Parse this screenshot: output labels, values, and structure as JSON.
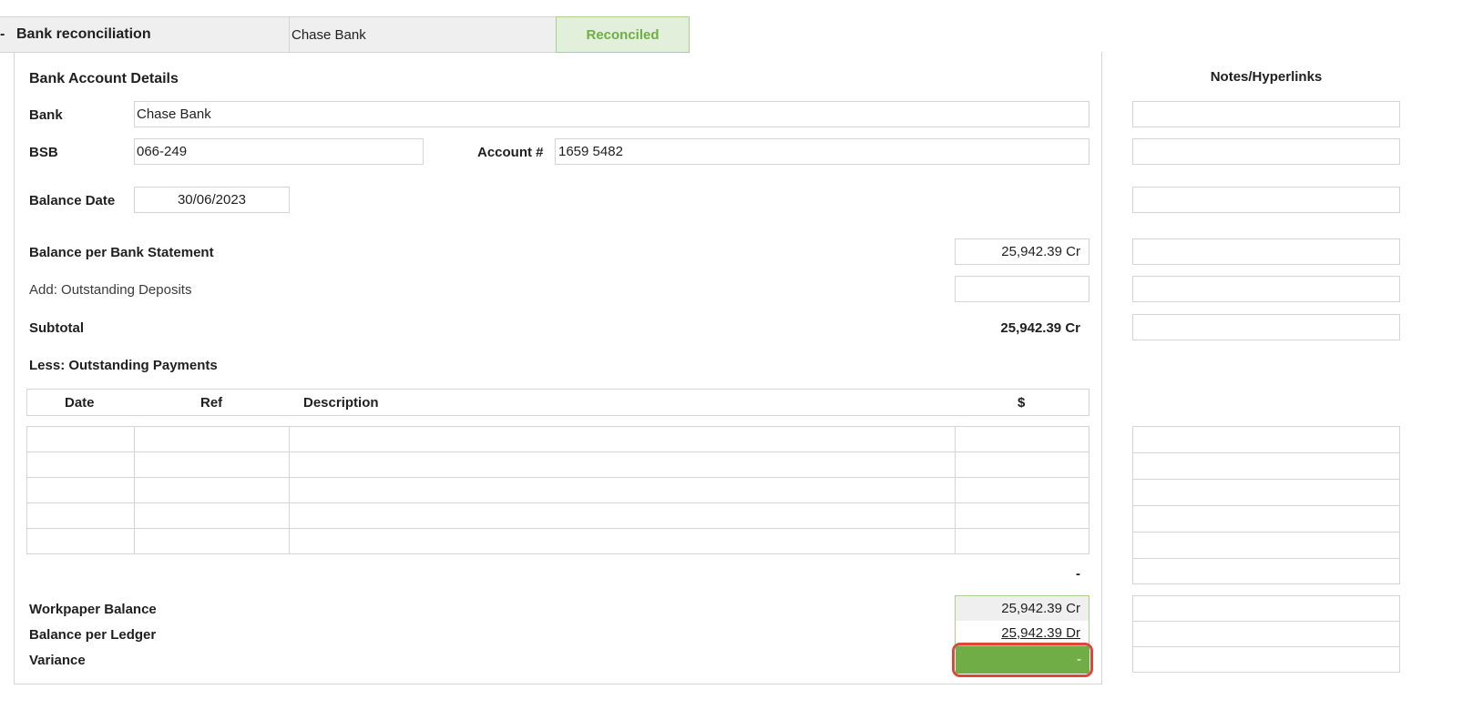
{
  "header": {
    "collapse_marker": "-",
    "title": "Bank reconciliation",
    "bank": "Chase Bank",
    "status": "Reconciled"
  },
  "details": {
    "section_title": "Bank Account Details",
    "bank_label": "Bank",
    "bank_value": "Chase Bank",
    "bsb_label": "BSB",
    "bsb_value": "066-249",
    "account_label": "Account #",
    "account_value": "1659 5482",
    "balance_date_label": "Balance Date",
    "balance_date_value": "30/06/2023"
  },
  "summary": {
    "bank_statement_label": "Balance per Bank Statement",
    "bank_statement_value": "25,942.39 Cr",
    "outstanding_deposits_label": "Add: Outstanding Deposits",
    "outstanding_deposits_value": "",
    "subtotal_label": "Subtotal",
    "subtotal_value": "25,942.39 Cr",
    "outstanding_payments_label": "Less: Outstanding Payments"
  },
  "payments_table": {
    "columns": [
      "Date",
      "Ref",
      "Description",
      "$"
    ],
    "rows": [
      [
        "",
        "",
        "",
        ""
      ],
      [
        "",
        "",
        "",
        ""
      ],
      [
        "",
        "",
        "",
        ""
      ],
      [
        "",
        "",
        "",
        ""
      ],
      [
        "",
        "",
        "",
        ""
      ]
    ],
    "total": "-"
  },
  "totals": {
    "workpaper_label": "Workpaper Balance",
    "workpaper_value": "25,942.39 Cr",
    "ledger_label": "Balance per Ledger",
    "ledger_value": "25,942.39 Dr",
    "variance_label": "Variance",
    "variance_value": "-"
  },
  "notes": {
    "title": "Notes/Hyperlinks"
  },
  "colors": {
    "accent_green": "#70ad47",
    "reconciled_bg": "#e2efda",
    "highlight_red": "#e0443a"
  }
}
